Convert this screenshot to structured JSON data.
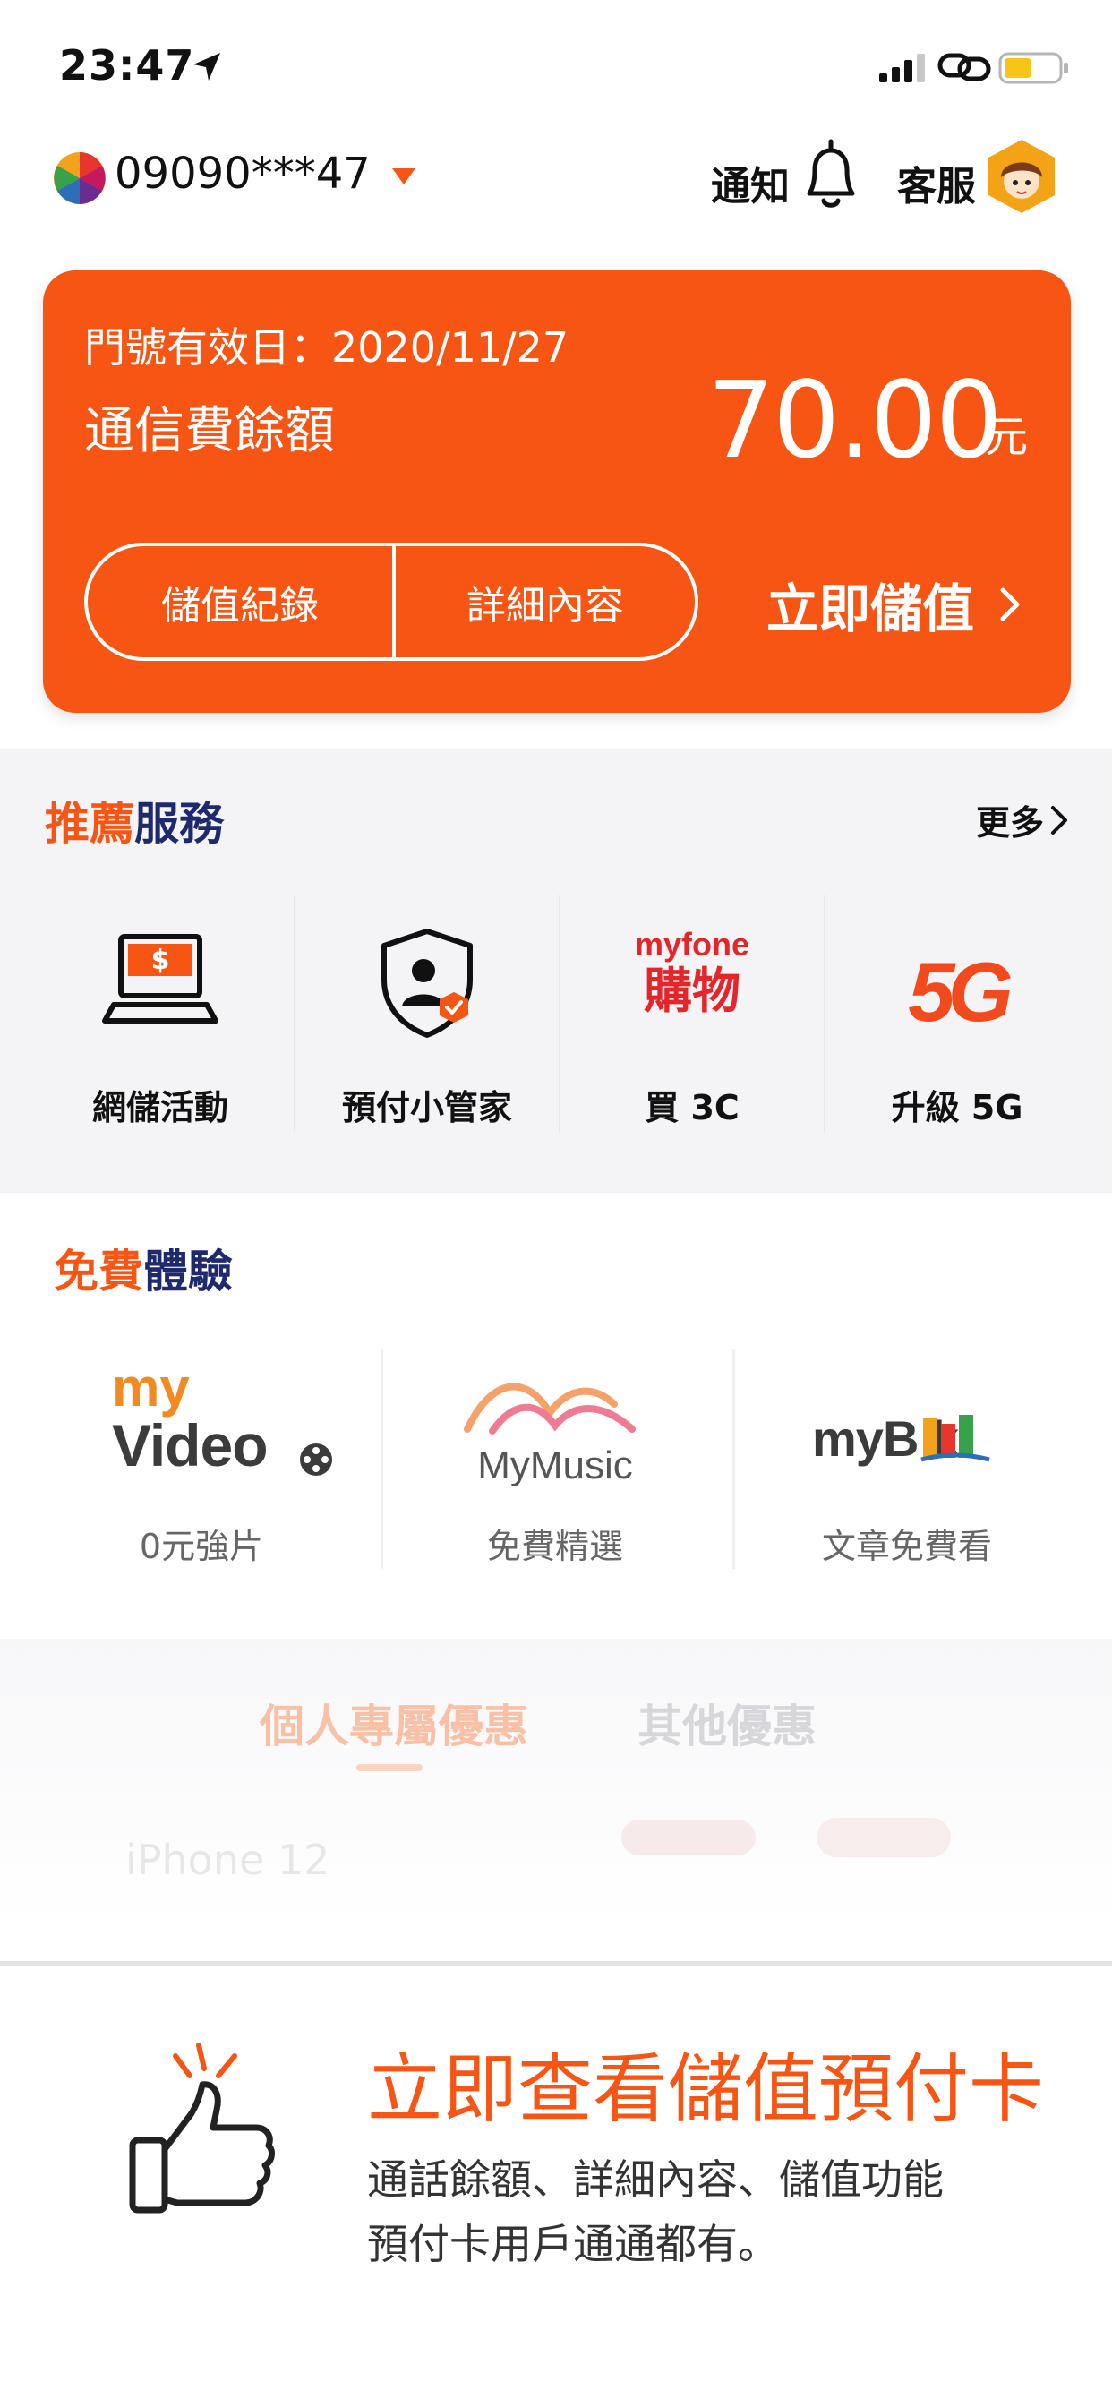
{
  "status_bar": {
    "time": "23:47"
  },
  "header": {
    "phone_number": "09090***47",
    "notify_label": "通知",
    "service_label": "客服"
  },
  "balance_card": {
    "expiry": "門號有效日：2020/11/27",
    "balance_label": "通信費餘額",
    "balance_amount": "70.00",
    "balance_unit": "元",
    "history_button": "儲值紀錄",
    "detail_button": "詳細內容",
    "topup_button": "立即儲值"
  },
  "recommended": {
    "title_part1": "推薦",
    "title_part2": "服務",
    "more": "更多",
    "items": [
      {
        "label": "網儲活動",
        "icon": "laptop-dollar-icon"
      },
      {
        "label": "預付小管家",
        "icon": "shield-user-icon"
      },
      {
        "label": "買 3C",
        "icon": "myfone-shopping-logo",
        "logo_top": "myfone",
        "logo_bottom": "購物"
      },
      {
        "label": "升級 5G",
        "icon": "5g-icon",
        "logo_text": "5G"
      }
    ]
  },
  "free_trial": {
    "title_part1": "免費",
    "title_part2": "體驗",
    "items": [
      {
        "label": "0元強片",
        "logo": "myvideo-logo",
        "logo_line1": "my",
        "logo_line2": "Video"
      },
      {
        "label": "免費精選",
        "logo": "mymusic-logo",
        "logo_text": "MyMusic"
      },
      {
        "label": "文章免費看",
        "logo": "mybook-logo",
        "logo_text": "myB k"
      }
    ]
  },
  "offers": {
    "tabs": [
      "個人專屬優惠",
      "其他優惠"
    ],
    "faded_text": "iPhone 12"
  },
  "promo": {
    "title": "立即查看儲值預付卡",
    "line1": "通話餘額、詳細內容、儲值功能",
    "line2": "預付卡用戶通通都有。"
  },
  "colors": {
    "brand_orange": "#f75513",
    "brand_navy": "#1f2a6e",
    "section_bg": "#f4f4f7"
  }
}
